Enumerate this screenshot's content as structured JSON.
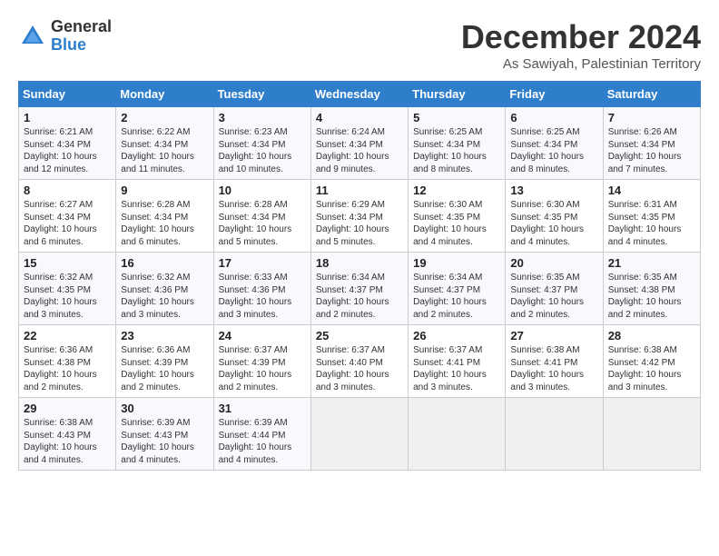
{
  "logo": {
    "line1": "General",
    "line2": "Blue"
  },
  "title": "December 2024",
  "subtitle": "As Sawiyah, Palestinian Territory",
  "days_of_week": [
    "Sunday",
    "Monday",
    "Tuesday",
    "Wednesday",
    "Thursday",
    "Friday",
    "Saturday"
  ],
  "weeks": [
    [
      {
        "day": 1,
        "info": "Sunrise: 6:21 AM\nSunset: 4:34 PM\nDaylight: 10 hours\nand 12 minutes."
      },
      {
        "day": 2,
        "info": "Sunrise: 6:22 AM\nSunset: 4:34 PM\nDaylight: 10 hours\nand 11 minutes."
      },
      {
        "day": 3,
        "info": "Sunrise: 6:23 AM\nSunset: 4:34 PM\nDaylight: 10 hours\nand 10 minutes."
      },
      {
        "day": 4,
        "info": "Sunrise: 6:24 AM\nSunset: 4:34 PM\nDaylight: 10 hours\nand 9 minutes."
      },
      {
        "day": 5,
        "info": "Sunrise: 6:25 AM\nSunset: 4:34 PM\nDaylight: 10 hours\nand 8 minutes."
      },
      {
        "day": 6,
        "info": "Sunrise: 6:25 AM\nSunset: 4:34 PM\nDaylight: 10 hours\nand 8 minutes."
      },
      {
        "day": 7,
        "info": "Sunrise: 6:26 AM\nSunset: 4:34 PM\nDaylight: 10 hours\nand 7 minutes."
      }
    ],
    [
      {
        "day": 8,
        "info": "Sunrise: 6:27 AM\nSunset: 4:34 PM\nDaylight: 10 hours\nand 6 minutes."
      },
      {
        "day": 9,
        "info": "Sunrise: 6:28 AM\nSunset: 4:34 PM\nDaylight: 10 hours\nand 6 minutes."
      },
      {
        "day": 10,
        "info": "Sunrise: 6:28 AM\nSunset: 4:34 PM\nDaylight: 10 hours\nand 5 minutes."
      },
      {
        "day": 11,
        "info": "Sunrise: 6:29 AM\nSunset: 4:34 PM\nDaylight: 10 hours\nand 5 minutes."
      },
      {
        "day": 12,
        "info": "Sunrise: 6:30 AM\nSunset: 4:35 PM\nDaylight: 10 hours\nand 4 minutes."
      },
      {
        "day": 13,
        "info": "Sunrise: 6:30 AM\nSunset: 4:35 PM\nDaylight: 10 hours\nand 4 minutes."
      },
      {
        "day": 14,
        "info": "Sunrise: 6:31 AM\nSunset: 4:35 PM\nDaylight: 10 hours\nand 4 minutes."
      }
    ],
    [
      {
        "day": 15,
        "info": "Sunrise: 6:32 AM\nSunset: 4:35 PM\nDaylight: 10 hours\nand 3 minutes."
      },
      {
        "day": 16,
        "info": "Sunrise: 6:32 AM\nSunset: 4:36 PM\nDaylight: 10 hours\nand 3 minutes."
      },
      {
        "day": 17,
        "info": "Sunrise: 6:33 AM\nSunset: 4:36 PM\nDaylight: 10 hours\nand 3 minutes."
      },
      {
        "day": 18,
        "info": "Sunrise: 6:34 AM\nSunset: 4:37 PM\nDaylight: 10 hours\nand 2 minutes."
      },
      {
        "day": 19,
        "info": "Sunrise: 6:34 AM\nSunset: 4:37 PM\nDaylight: 10 hours\nand 2 minutes."
      },
      {
        "day": 20,
        "info": "Sunrise: 6:35 AM\nSunset: 4:37 PM\nDaylight: 10 hours\nand 2 minutes."
      },
      {
        "day": 21,
        "info": "Sunrise: 6:35 AM\nSunset: 4:38 PM\nDaylight: 10 hours\nand 2 minutes."
      }
    ],
    [
      {
        "day": 22,
        "info": "Sunrise: 6:36 AM\nSunset: 4:38 PM\nDaylight: 10 hours\nand 2 minutes."
      },
      {
        "day": 23,
        "info": "Sunrise: 6:36 AM\nSunset: 4:39 PM\nDaylight: 10 hours\nand 2 minutes."
      },
      {
        "day": 24,
        "info": "Sunrise: 6:37 AM\nSunset: 4:39 PM\nDaylight: 10 hours\nand 2 minutes."
      },
      {
        "day": 25,
        "info": "Sunrise: 6:37 AM\nSunset: 4:40 PM\nDaylight: 10 hours\nand 3 minutes."
      },
      {
        "day": 26,
        "info": "Sunrise: 6:37 AM\nSunset: 4:41 PM\nDaylight: 10 hours\nand 3 minutes."
      },
      {
        "day": 27,
        "info": "Sunrise: 6:38 AM\nSunset: 4:41 PM\nDaylight: 10 hours\nand 3 minutes."
      },
      {
        "day": 28,
        "info": "Sunrise: 6:38 AM\nSunset: 4:42 PM\nDaylight: 10 hours\nand 3 minutes."
      }
    ],
    [
      {
        "day": 29,
        "info": "Sunrise: 6:38 AM\nSunset: 4:43 PM\nDaylight: 10 hours\nand 4 minutes."
      },
      {
        "day": 30,
        "info": "Sunrise: 6:39 AM\nSunset: 4:43 PM\nDaylight: 10 hours\nand 4 minutes."
      },
      {
        "day": 31,
        "info": "Sunrise: 6:39 AM\nSunset: 4:44 PM\nDaylight: 10 hours\nand 4 minutes."
      },
      null,
      null,
      null,
      null
    ]
  ]
}
